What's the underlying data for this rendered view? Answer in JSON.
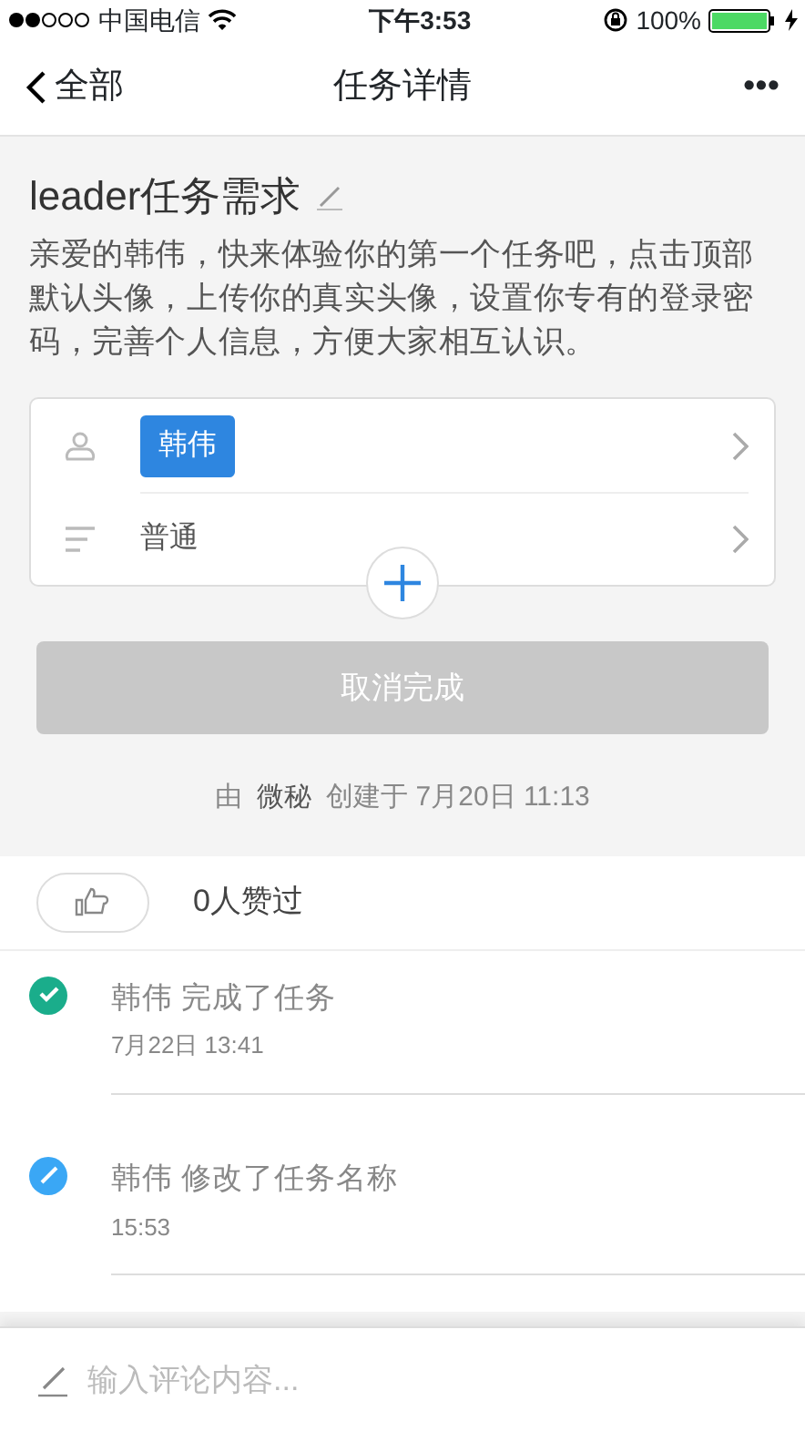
{
  "status_bar": {
    "carrier": "中国电信",
    "time": "下午3:53",
    "battery": "100%"
  },
  "nav": {
    "back": "全部",
    "title": "任务详情",
    "more": "•••"
  },
  "task": {
    "title": "leader任务需求",
    "description": "亲爱的韩伟，快来体验你的第一个任务吧，点击顶部默认头像，上传你的真实头像，设置你专有的登录密码，完善个人信息，方便大家相互认识。"
  },
  "fields": [
    {
      "kind": "assignee",
      "value": "韩伟"
    },
    {
      "kind": "priority",
      "value": "普通"
    }
  ],
  "complete_button": {
    "label": "取消完成",
    "disabled": true
  },
  "created": {
    "prefix": "由",
    "creator": "微秘",
    "suffix": "创建于 7月20日 11:13"
  },
  "likes": {
    "count_text": "0人赞过"
  },
  "activities": [
    {
      "kind": "completed",
      "text": "韩伟 完成了任务",
      "time": "7月22日 13:41",
      "color": "#1aad8b"
    },
    {
      "kind": "renamed",
      "text": "韩伟 修改了任务名称",
      "time": "15:53",
      "color": "#3aa7f5"
    }
  ],
  "comment": {
    "placeholder": "输入评论内容..."
  }
}
